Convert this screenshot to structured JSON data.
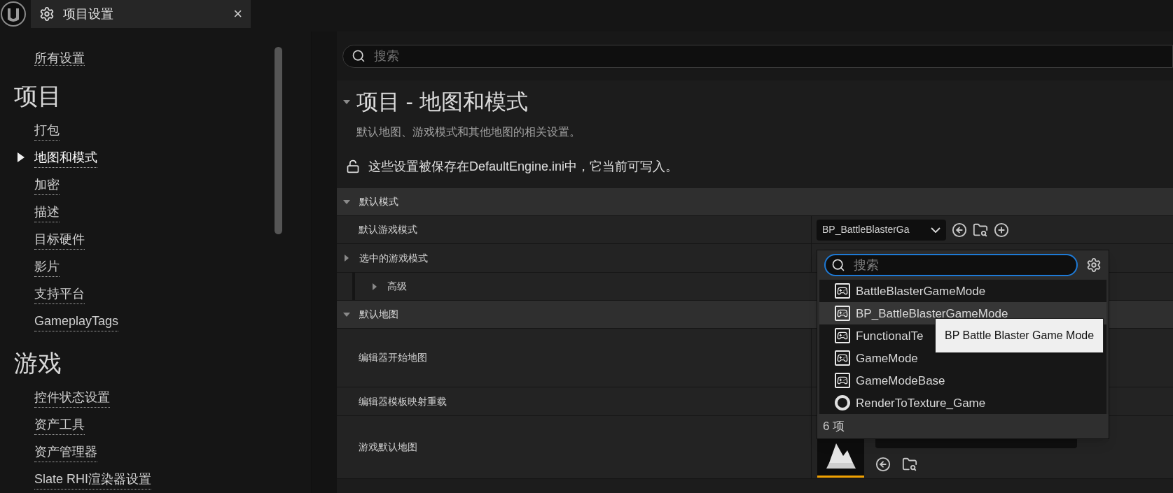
{
  "tab": {
    "title": "项目设置",
    "close": "×"
  },
  "sidebar": {
    "top_link": "所有设置",
    "sections": [
      {
        "heading": "项目",
        "items": [
          {
            "label": "打包",
            "selected": false
          },
          {
            "label": "地图和模式",
            "selected": true
          },
          {
            "label": "加密",
            "selected": false
          },
          {
            "label": "描述",
            "selected": false
          },
          {
            "label": "目标硬件",
            "selected": false
          },
          {
            "label": "影片",
            "selected": false
          },
          {
            "label": "支持平台",
            "selected": false
          },
          {
            "label": "GameplayTags",
            "selected": false
          }
        ]
      },
      {
        "heading": "游戏",
        "items": [
          {
            "label": "控件状态设置",
            "selected": false
          },
          {
            "label": "资产工具",
            "selected": false
          },
          {
            "label": "资产管理器",
            "selected": false
          },
          {
            "label": "Slate RHI渲染器设置",
            "selected": false
          }
        ]
      }
    ]
  },
  "search": {
    "placeholder": "搜索"
  },
  "page": {
    "title": "项目 - 地图和模式",
    "expanded": true,
    "description": "默认地图、游戏模式和其他地图的相关设置。",
    "notice": "这些设置被保存在DefaultEngine.ini中，它当前可写入。"
  },
  "categories": [
    {
      "label": "默认模式",
      "expanded": true,
      "rows": [
        {
          "label": "默认游戏模式",
          "kind": "class",
          "value": "BP_BattleBlasterGa"
        },
        {
          "label": "选中的游戏模式",
          "kind": "group",
          "expanded": false
        },
        {
          "label": "高级",
          "kind": "advanced",
          "expanded": false
        }
      ]
    },
    {
      "label": "默认地图",
      "expanded": true,
      "rows": [
        {
          "label": "编辑器开始地图",
          "kind": "tall"
        },
        {
          "label": "编辑器模板映射重载",
          "kind": "plain"
        },
        {
          "label": "游戏默认地图",
          "kind": "map"
        }
      ]
    }
  ],
  "picker": {
    "placeholder": "搜索",
    "items": [
      {
        "label": "BattleBlasterGameMode",
        "kind": "gamemode",
        "selected": false
      },
      {
        "label": "BP_BattleBlasterGameMode",
        "kind": "gamemode",
        "selected": true
      },
      {
        "label": "FunctionalTe",
        "kind": "gamemode",
        "selected": false
      },
      {
        "label": "GameMode",
        "kind": "gamemode",
        "selected": false
      },
      {
        "label": "GameModeBase",
        "kind": "gamemode",
        "selected": false
      },
      {
        "label": "RenderToTexture_Game",
        "kind": "ring",
        "selected": false
      }
    ],
    "count": "6 项",
    "tooltip": "BP Battle Blaster Game Mode"
  }
}
